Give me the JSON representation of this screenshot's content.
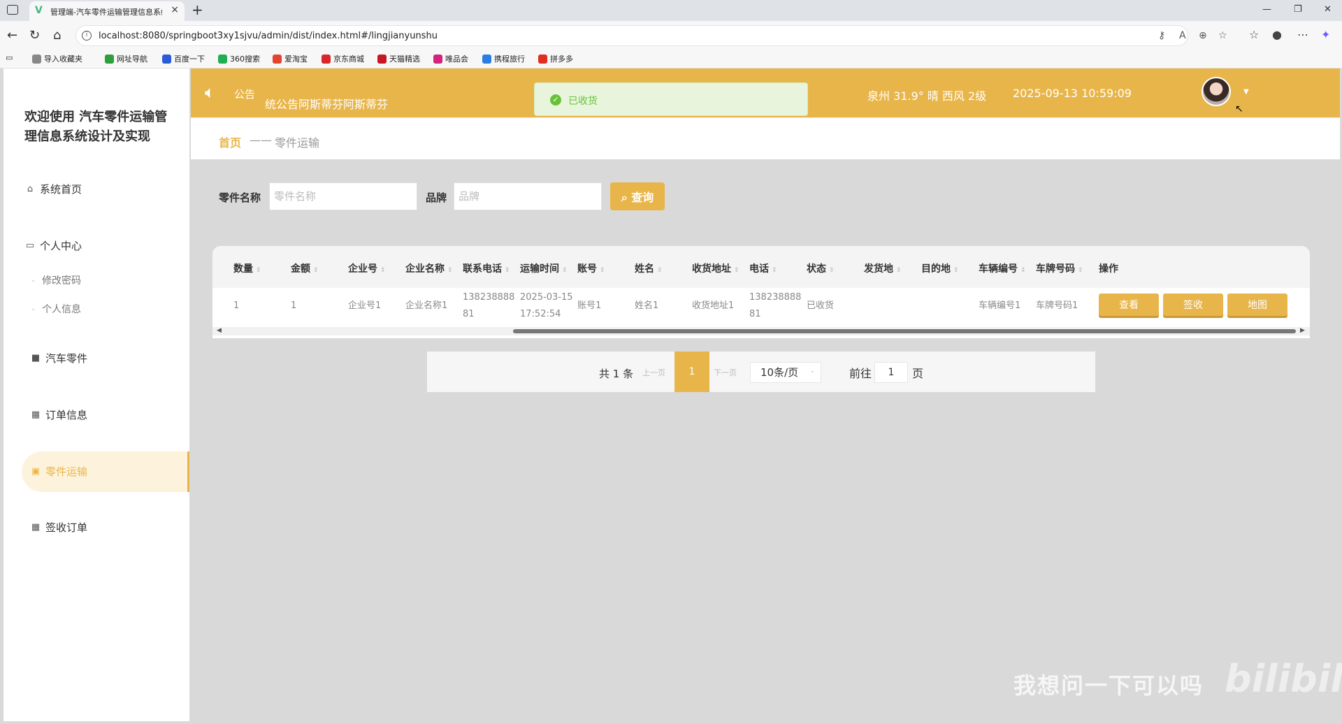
{
  "browser": {
    "tab_title": "管理端-汽车零件运输管理信息系统",
    "url": "localhost:8080/springboot3xy1sjvu/admin/dist/index.html#/lingjianyunshu",
    "bookmarks": [
      {
        "label": "导入收藏夹",
        "color": "#888888"
      },
      {
        "label": "网址导航",
        "color": "#2e9f3c"
      },
      {
        "label": "百度一下",
        "color": "#2b5cd8"
      },
      {
        "label": "360搜索",
        "color": "#1fae53"
      },
      {
        "label": "爱淘宝",
        "color": "#e2452f"
      },
      {
        "label": "京东商城",
        "color": "#d8262b"
      },
      {
        "label": "天猫精选",
        "color": "#c81623"
      },
      {
        "label": "唯品会",
        "color": "#d2247c"
      },
      {
        "label": "携程旅行",
        "color": "#2a7de1"
      },
      {
        "label": "拼多多",
        "color": "#e02e24"
      }
    ]
  },
  "sidebar": {
    "brand": "欢迎使用 汽车零件运输管理信息系统设计及实现",
    "items": [
      {
        "label": "系统首页",
        "icon": "home-icon"
      },
      {
        "label": "个人中心",
        "icon": "id-card-icon"
      },
      {
        "label": "汽车零件",
        "icon": "video-icon"
      },
      {
        "label": "订单信息",
        "icon": "grid-icon"
      },
      {
        "label": "零件运输",
        "icon": "clipboard-icon"
      },
      {
        "label": "签收订单",
        "icon": "grid-icon"
      }
    ],
    "sub_items": [
      "修改密码",
      "个人信息"
    ]
  },
  "header": {
    "notice_label": "公告",
    "notice_text": "统公告阿斯蒂芬阿斯蒂芬",
    "weather": "泉州  31.9°  晴  西风  2级",
    "datetime": "2025-09-13 10:59:09"
  },
  "toast": {
    "text": "已收货"
  },
  "breadcrumb": {
    "home": "首页",
    "separator": "——",
    "current": "零件运输"
  },
  "search": {
    "name_label": "零件名称",
    "name_placeholder": "零件名称",
    "brand_label": "品牌",
    "brand_placeholder": "品牌",
    "button": "查询"
  },
  "table": {
    "headers": [
      "数量",
      "金额",
      "企业号",
      "企业名称",
      "联系电话",
      "运输时间",
      "账号",
      "姓名",
      "收货地址",
      "电话",
      "状态",
      "发货地",
      "目的地",
      "车辆编号",
      "车牌号码",
      "操作"
    ],
    "row": {
      "qty": "1",
      "amount": "1",
      "company_no": "企业号1",
      "company_name": "企业名称1",
      "phone_a": "138238888",
      "phone_b": "81",
      "time_a": "2025-03-15",
      "time_b": "17:52:54",
      "account": "账号1",
      "name": "姓名1",
      "address": "收货地址1",
      "tel_a": "138238888",
      "tel_b": "81",
      "status": "已收货",
      "origin": "",
      "destination": "",
      "vehicle_no": "车辆编号1",
      "plate": "车牌号码1"
    },
    "actions": [
      "查看",
      "签收",
      "地图"
    ]
  },
  "pagination": {
    "total": "共 1 条",
    "prev": "上一页",
    "current": "1",
    "next": "下一页",
    "page_size": "10条/页",
    "goto": "前往",
    "goto_value": "1",
    "page_unit": "页"
  },
  "watermark": {
    "text": "我想问一下可以吗",
    "logo": "bilibili"
  },
  "colors": {
    "accent": "#e8b54a",
    "success": "#67c23a"
  }
}
